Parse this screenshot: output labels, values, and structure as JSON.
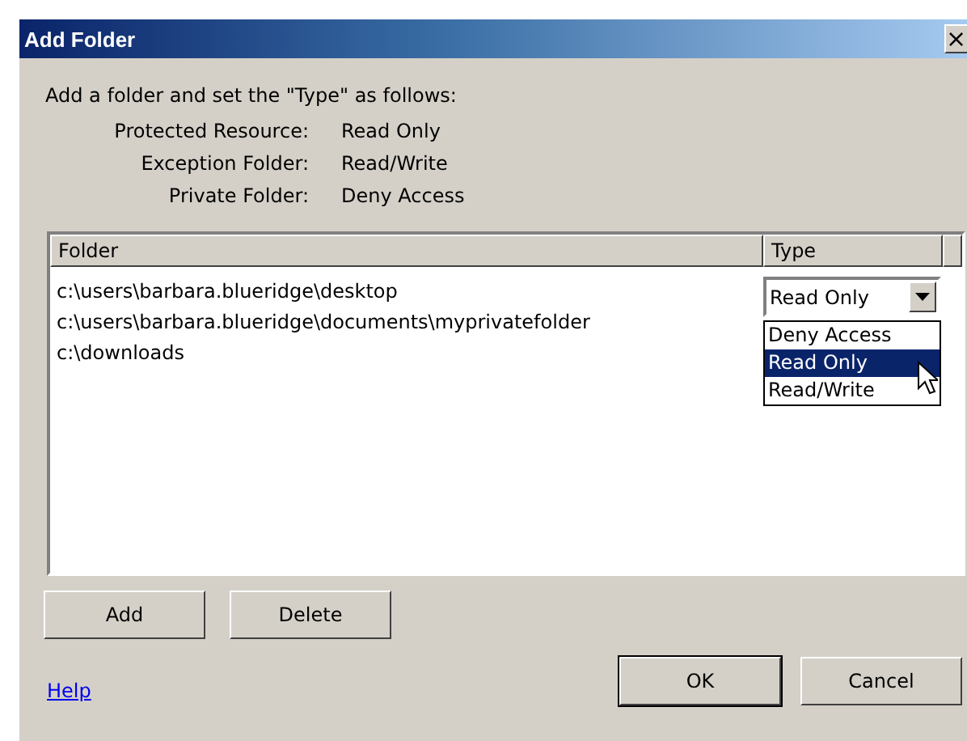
{
  "window": {
    "title": "Add Folder",
    "close": "×"
  },
  "intro": "Add a folder and set the \"Type\" as follows:",
  "legend": [
    {
      "label": "Protected Resource:",
      "value": "Read Only"
    },
    {
      "label": "Exception Folder:",
      "value": "Read/Write"
    },
    {
      "label": "Private Folder:",
      "value": "Deny Access"
    }
  ],
  "list": {
    "columns": [
      "Folder",
      "Type"
    ],
    "rows": [
      {
        "folder": "c:\\users\\barbara.blueridge\\desktop"
      },
      {
        "folder": "c:\\users\\barbara.blueridge\\documents\\myprivatefolder"
      },
      {
        "folder": "c:\\downloads"
      }
    ],
    "type_dropdown": {
      "value": "Read Only",
      "expanded": true,
      "options": [
        {
          "label": "Deny Access",
          "selected": false
        },
        {
          "label": "Read Only",
          "selected": true
        },
        {
          "label": "Read/Write",
          "selected": false
        }
      ]
    }
  },
  "buttons": [
    {
      "label": "Add",
      "default": false
    },
    {
      "label": "Delete",
      "default": false
    }
  ],
  "help_link": "Help",
  "dialog_buttons": [
    {
      "label": "OK",
      "default": true
    },
    {
      "label": "Cancel",
      "default": false
    }
  ]
}
